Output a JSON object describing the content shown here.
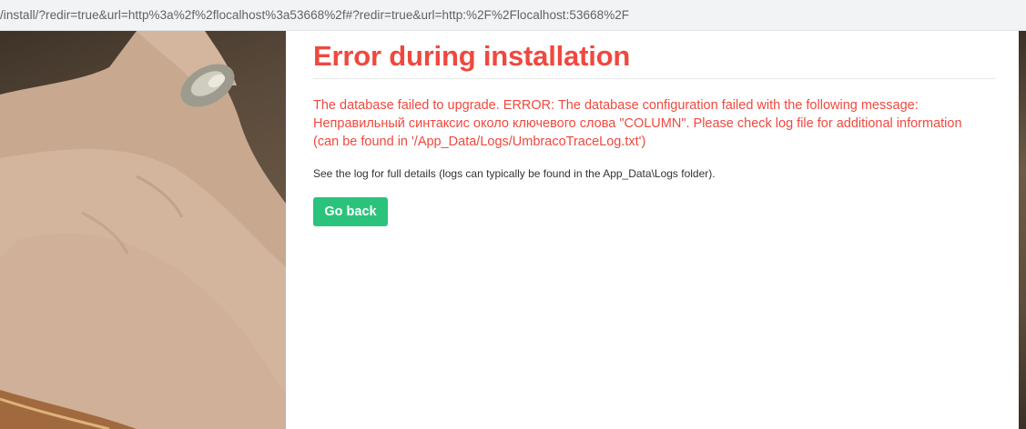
{
  "browser": {
    "url": "/install/?redir=true&url=http%3a%2f%2flocalhost%3a53668%2f#?redir=true&url=http:%2F%2Flocalhost:53668%2F"
  },
  "error": {
    "title": "Error during installation",
    "message_lines": [
      "The database failed to upgrade. ERROR: The database configuration failed with the following message:",
      "Неправильный синтаксис около ключевого слова \"COLUMN\". Please check log file for additional information",
      "(can be found in '/App_Data/Logs/UmbracoTraceLog.txt')"
    ],
    "hint": "See the log for full details (logs can typically be found in the App_Data\\Logs folder).",
    "button_label": "Go back"
  },
  "colors": {
    "error_red": "#f0483e",
    "button_green": "#2bc37c",
    "address_bar_bg": "#f1f3f4"
  }
}
